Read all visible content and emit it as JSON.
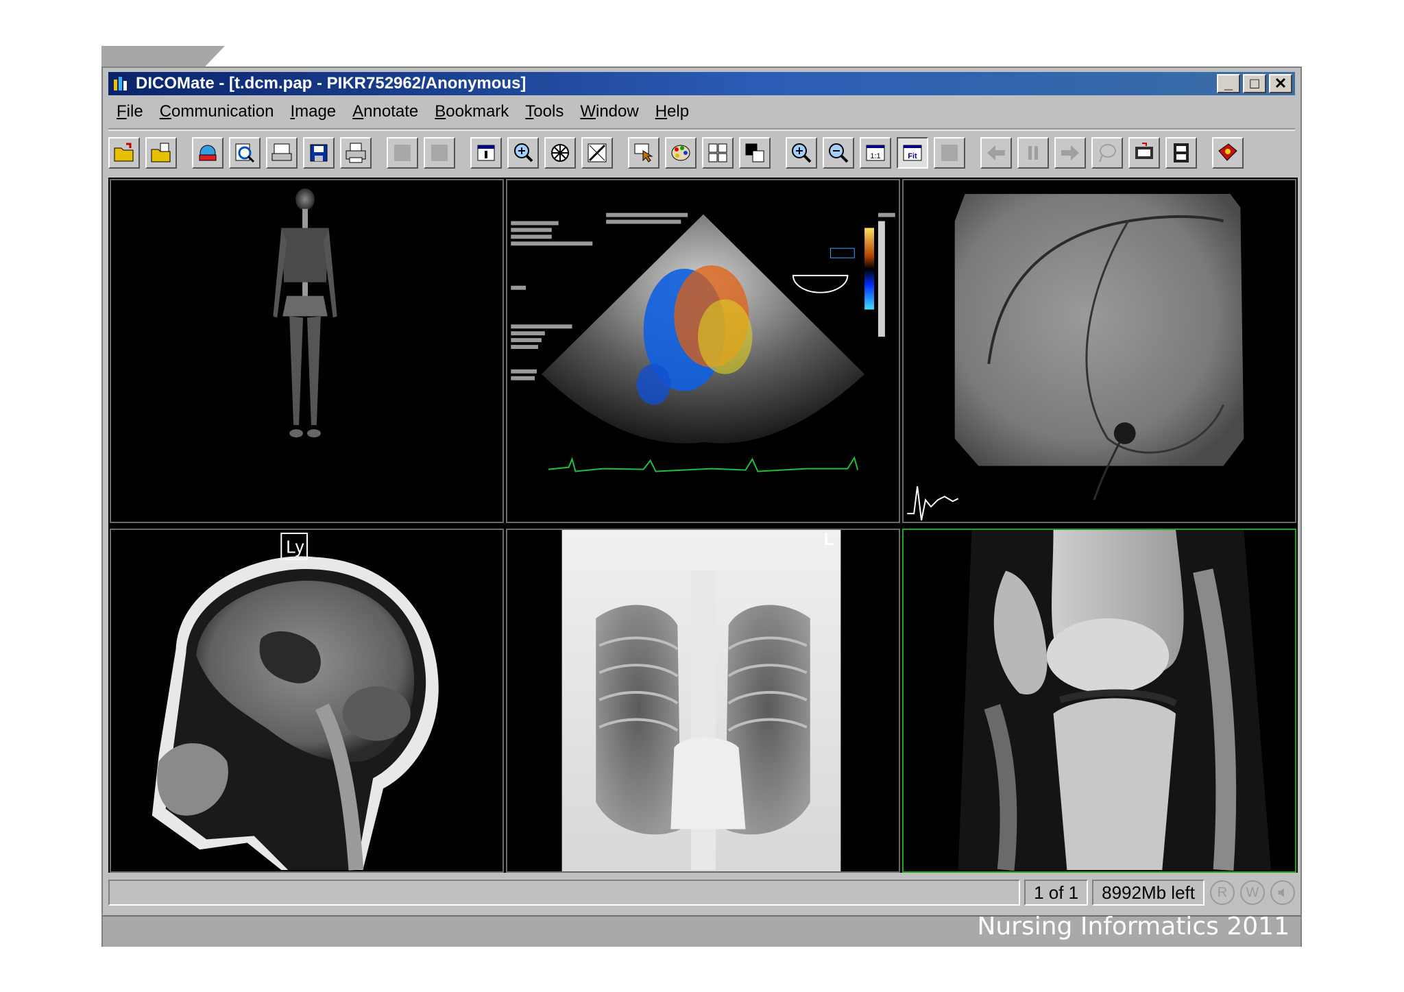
{
  "window": {
    "title": "DICOMate - [t.dcm.pap - PIKR752962/Anonymous]",
    "controls": {
      "minimize": "_",
      "maximize": "□",
      "close": "✕"
    }
  },
  "menu": {
    "items": [
      "File",
      "Communication",
      "Image",
      "Annotate",
      "Bookmark",
      "Tools",
      "Window",
      "Help"
    ]
  },
  "toolbar": {
    "buttons": [
      "open-folder-icon",
      "open-file-icon",
      "network-icon",
      "search-icon",
      "print-preview-icon",
      "save-icon",
      "print-icon",
      "blank-icon",
      "blank-icon",
      "info-icon",
      "magnifier-icon",
      "cine-wheel-icon",
      "annotate-icon",
      "pointer-icon",
      "palette-icon",
      "layout-icon",
      "compare-icon",
      "zoom-in-icon",
      "zoom-out-icon",
      "actual-size-icon",
      "fit-icon",
      "blank-icon",
      "back-arrow-icon",
      "pause-icon",
      "forward-arrow-icon",
      "lasso-icon",
      "filmstrip-icon",
      "film-icon",
      "help-book-icon"
    ],
    "actual_size_label": "1:1",
    "fit_label": "Fit"
  },
  "viewer": {
    "panes": [
      {
        "name": "bone-scan"
      },
      {
        "name": "echocardiogram"
      },
      {
        "name": "angiogram"
      },
      {
        "name": "brain-mri",
        "marker": "Ly"
      },
      {
        "name": "chest-xray",
        "marker": "L"
      },
      {
        "name": "knee-mri"
      }
    ]
  },
  "status": {
    "page": "1 of 1",
    "free_space": "8992Mb left",
    "icons": [
      "R",
      "W",
      "speaker-icon"
    ]
  },
  "footer": {
    "text": "Nursing Informatics 2011"
  },
  "colors": {
    "titlebar": "#0a246a",
    "active_pane_border": "#1aa51a",
    "window_bg": "#c0c0c0"
  }
}
